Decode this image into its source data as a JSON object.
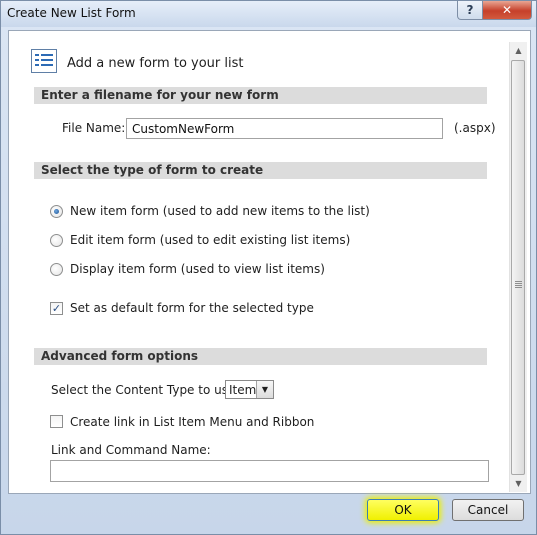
{
  "window": {
    "title": "Create New List Form",
    "help_label": "?",
    "close_label": "✕"
  },
  "header": {
    "title": "Add a new form to your list",
    "icon": "list-form-icon"
  },
  "filename_section": {
    "header": "Enter a filename for your new form",
    "label": "File Name:",
    "value": "CustomNewForm",
    "suffix": "(.aspx)"
  },
  "form_type_section": {
    "header": "Select the type of form to create",
    "options": [
      {
        "label": "New item form (used to add new items to the list)",
        "selected": true
      },
      {
        "label": "Edit item form (used to edit existing list items)",
        "selected": false
      },
      {
        "label": "Display item form (used to view list items)",
        "selected": false
      }
    ],
    "default_checkbox": {
      "label": "Set as default form for the selected type",
      "checked": true,
      "mark": "✓"
    }
  },
  "advanced_section": {
    "header": "Advanced form options",
    "content_type_label": "Select the Content Type to use:",
    "content_type_value": "Item",
    "create_link_checkbox": {
      "label": "Create link in List Item Menu and Ribbon",
      "checked": false,
      "mark": ""
    },
    "link_name_label": "Link and Command Name:",
    "link_name_value": ""
  },
  "footer": {
    "ok_label": "OK",
    "cancel_label": "Cancel"
  },
  "colors": {
    "ok_highlight": "#f0f000",
    "section_header_bg": "#dcdcdc",
    "close_button": "#c6402a"
  }
}
